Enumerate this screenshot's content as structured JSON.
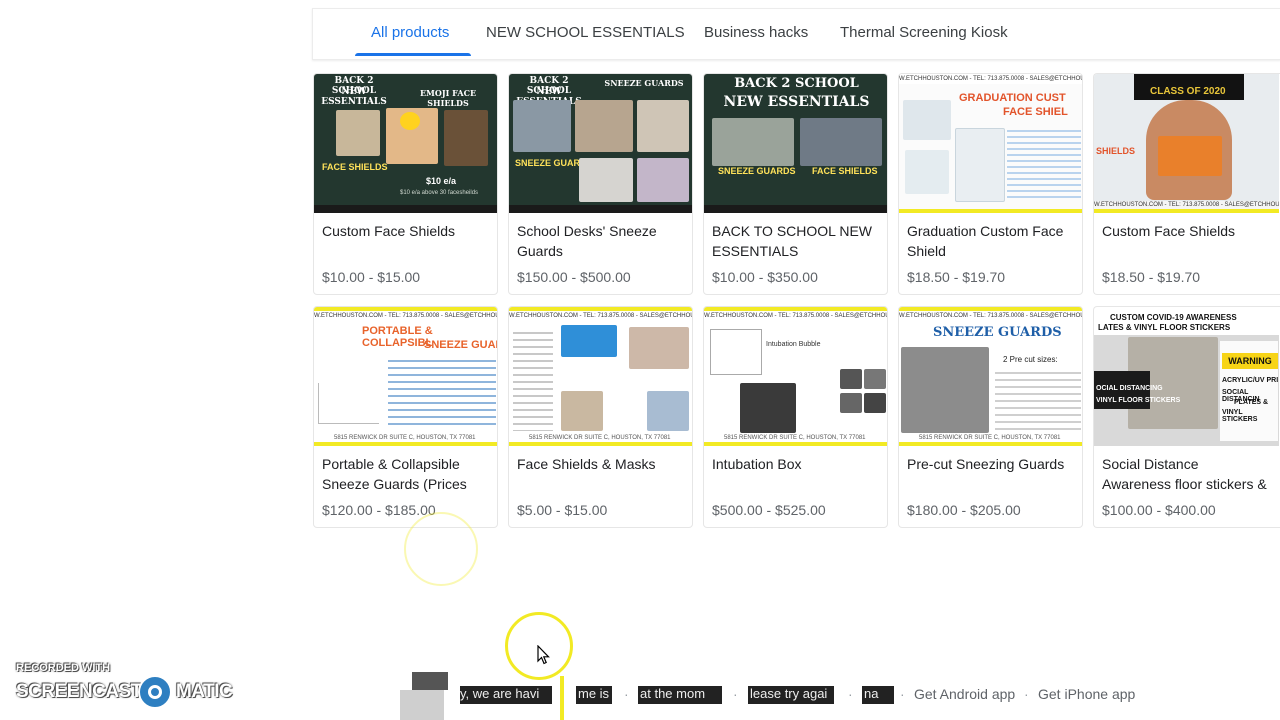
{
  "tabs": [
    {
      "label": "All products",
      "active": true
    },
    {
      "label": "NEW SCHOOL ESSENTIALS",
      "active": false
    },
    {
      "label": "Business hacks",
      "active": false
    },
    {
      "label": "Thermal Screening Kiosk",
      "active": false
    }
  ],
  "products": [
    {
      "title": "Custom Face Shields",
      "price": "$10.00 - $15.00",
      "thumb": {
        "heading": "BACK 2 SCHOOL",
        "heading2": "NEW ESSENTIALS",
        "right_heading": "EMOJI FACE SHIELDS",
        "caption": "FACE SHIELDS",
        "note": "$10 e/a",
        "note2": "$10 e/a above 30 facesheilds"
      }
    },
    {
      "title": "School Desks' Sneeze Guards",
      "price": "$150.00 - $500.00",
      "thumb": {
        "heading": "BACK 2 SCHOOL",
        "heading2": "NEW ESSENTIALS",
        "right_heading": "SNEEZE GUARDS",
        "caption": "SNEEZE GUARDS"
      }
    },
    {
      "title": "BACK TO SCHOOL NEW ESSENTIALS",
      "price": "$10.00 - $350.00",
      "thumb": {
        "heading": "BACK 2 SCHOOL",
        "heading2": "NEW ESSENTIALS",
        "caption": "SNEEZE GUARDS",
        "caption2": "FACE SHIELDS"
      }
    },
    {
      "title": "Graduation Custom Face Shield",
      "price": "$18.50 - $19.70",
      "thumb": {
        "url": "W.ETCHHOUSTON.COM - TEL: 713.875.0008 - SALES@ETCHHOUSTON",
        "heading": "GRADUATION CUST",
        "heading2": "FACE SHIEL"
      }
    },
    {
      "title": "Custom Face Shields",
      "price": "$18.50 - $19.70",
      "thumb": {
        "url": "W.ETCHHOUSTON.COM - TEL: 713.875.0008 - SALES@ETCHHOUSTON",
        "side": "SHIELDS",
        "cap": "CLASS OF 2020"
      }
    },
    {
      "title": "Portable & Collapsible Sneeze Guards (Prices flu...",
      "price": "$120.00 - $185.00",
      "thumb": {
        "url": "W.ETCHHOUSTON.COM - TEL: 713.875.0008 - SALES@ETCHHOUSTON",
        "heading": "PORTABLE & COLLAPSIBL",
        "heading2": "SNEEZE GUAI",
        "footer": "5815 RENWICK DR SUITE C, HOUSTON, TX 77081"
      }
    },
    {
      "title": "Face Shields & Masks",
      "price": "$5.00 - $15.00",
      "thumb": {
        "url": "W.ETCHHOUSTON.COM - TEL: 713.875.0008 - SALES@ETCHHOUSTON",
        "footer": "5815 RENWICK DR SUITE C, HOUSTON, TX 77081"
      }
    },
    {
      "title": "Intubation Box",
      "price": "$500.00 - $525.00",
      "thumb": {
        "url": "W.ETCHHOUSTON.COM - TEL: 713.875.0008 - SALES@ETCHHOUSTON",
        "label": "Intubation Bubble",
        "footer": "5815 RENWICK DR SUITE C, HOUSTON, TX 77081"
      }
    },
    {
      "title": "Pre-cut Sneezing Guards",
      "price": "$180.00 - $205.00",
      "thumb": {
        "url": "W.ETCHHOUSTON.COM - TEL: 713.875.0008 - SALES@ETCHHOUSTON",
        "heading": "SNEEZE GUARDS",
        "note": "2 Pre cut sizes:",
        "footer": "5815 RENWICK DR SUITE C, HOUSTON, TX 77081"
      }
    },
    {
      "title": "Social Distance Awareness floor stickers & signs",
      "price": "$100.00 - $400.00",
      "thumb": {
        "heading": "CUSTOM COVID-19 AWARENESS",
        "heading2": "LATES & VINYL FLOOR STICKERS",
        "left": "OCIAL DISTANCING",
        "left2": "VINYL FLOOR STICKERS",
        "warn": "WARNING",
        "right": "ACRYLIC/UV PRI",
        "right2": "SOCIAL DISTANCIN",
        "right3": "PLATES &",
        "right4": "VINYL STICKERS"
      }
    }
  ],
  "footer": {
    "fragments": [
      "y, we are havi",
      "me is",
      "at the mom",
      "lease try agai",
      "na"
    ],
    "links": [
      "Get Android app",
      "Get iPhone app"
    ]
  },
  "watermark": {
    "line1": "RECORDED WITH",
    "left": "SCREENCAST",
    "right": "MATIC"
  },
  "colors": {
    "accent": "#1a73e8",
    "text": "#3c4043",
    "muted": "#5f6368",
    "highlight": "#f2ea24"
  }
}
